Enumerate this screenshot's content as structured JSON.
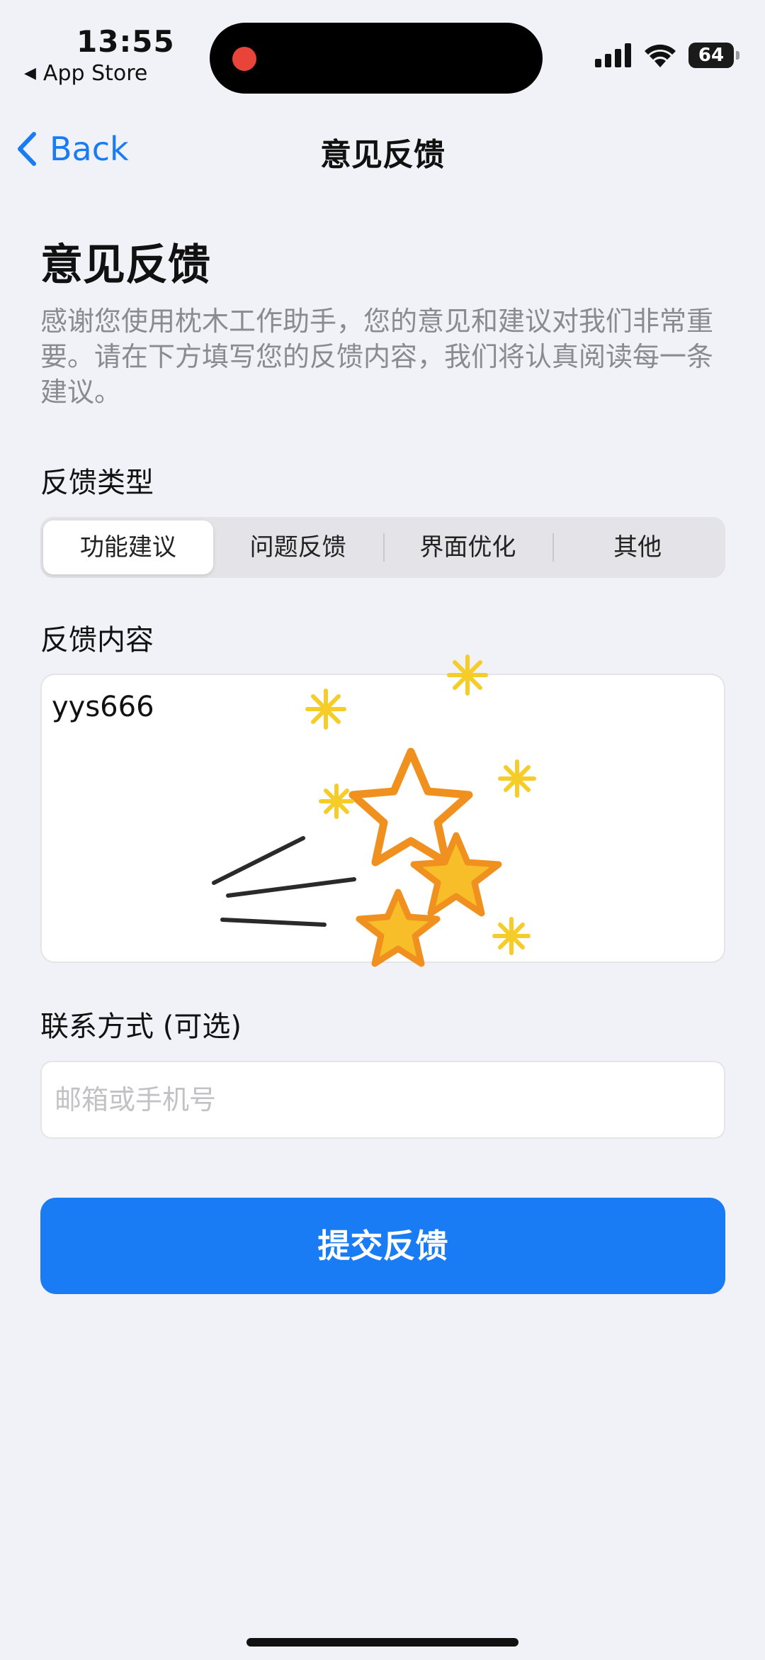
{
  "status_bar": {
    "time": "13:55",
    "back_app": "App Store",
    "battery": "64",
    "icons": [
      "signal-icon",
      "wifi-icon",
      "battery-icon"
    ],
    "recording_indicator_color": "#e8443a"
  },
  "nav": {
    "back_label": "Back",
    "title": "意见反馈"
  },
  "main": {
    "title": "意见反馈",
    "intro": "感谢您使用枕木工作助手，您的意见和建议对我们非常重要。请在下方填写您的反馈内容，我们将认真阅读每一条建议。",
    "type_label": "反馈类型",
    "type_options": [
      "功能建议",
      "问题反馈",
      "界面优化",
      "其他"
    ],
    "selected_type": "功能建议",
    "content_label": "反馈内容",
    "content_value": "yys666",
    "contact_label": "联系方式 (可选)",
    "contact_placeholder": "邮箱或手机号",
    "submit_label": "提交反馈"
  },
  "colors": {
    "accent": "#1a7cf5",
    "background": "#f1f2f7",
    "star_orange": "#f0901e",
    "star_yellow": "#f6cd28"
  }
}
